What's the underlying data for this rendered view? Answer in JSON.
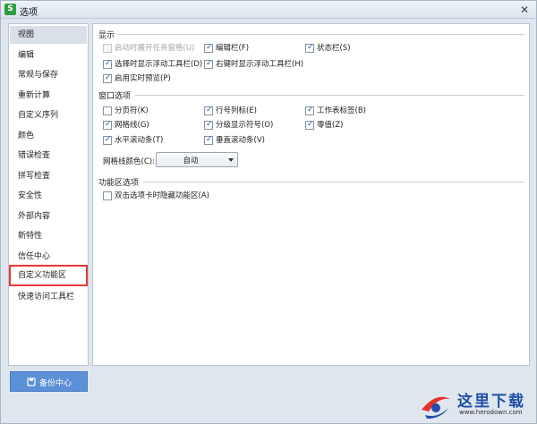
{
  "window": {
    "title": "选项",
    "app_icon_letter": "S"
  },
  "sidebar": {
    "items": [
      {
        "label": "视图",
        "selected": true
      },
      {
        "label": "编辑"
      },
      {
        "label": "常规与保存"
      },
      {
        "label": "重新计算"
      },
      {
        "label": "自定义序列"
      },
      {
        "label": "颜色"
      },
      {
        "label": "错误检查"
      },
      {
        "label": "拼写检查"
      },
      {
        "label": "安全性"
      },
      {
        "label": "外部内容"
      },
      {
        "label": "新特性"
      },
      {
        "label": "信任中心"
      },
      {
        "label": "自定义功能区",
        "highlighted": true
      },
      {
        "label": "快速访问工具栏"
      }
    ],
    "backup_button": "备份中心"
  },
  "display": {
    "title": "显示",
    "options": [
      {
        "label": "启动时展开任务窗格(U)",
        "checked": false,
        "disabled": true
      },
      {
        "label": "编辑栏(F)",
        "checked": true
      },
      {
        "label": "状态栏(S)",
        "checked": true
      },
      {
        "label": "选择时显示浮动工具栏(D)",
        "checked": true
      },
      {
        "label": "右键时显示浮动工具栏(H)",
        "checked": true
      },
      {
        "label": "启用实时预览(P)",
        "checked": true
      }
    ]
  },
  "window_options": {
    "title": "窗口选项",
    "options": [
      {
        "label": "分页符(K)",
        "checked": false
      },
      {
        "label": "行号列标(E)",
        "checked": true
      },
      {
        "label": "工作表标签(B)",
        "checked": true
      },
      {
        "label": "网格线(G)",
        "checked": true
      },
      {
        "label": "分级显示符号(O)",
        "checked": true
      },
      {
        "label": "零值(Z)",
        "checked": true
      },
      {
        "label": "水平滚动条(T)",
        "checked": true
      },
      {
        "label": "垂直滚动条(V)",
        "checked": true
      }
    ],
    "grid_color_label": "网格线颜色(C):",
    "grid_color_value": "自动"
  },
  "ribbon_options": {
    "title": "功能区选项",
    "options": [
      {
        "label": "双击选项卡时隐藏功能区(A)",
        "checked": false
      }
    ]
  },
  "watermark": {
    "title": "这里下载",
    "url": "www.herodown.com"
  },
  "colors": {
    "accent": "#5b8fd6",
    "highlight": "#e53935",
    "brand": "#1f4fa8"
  }
}
